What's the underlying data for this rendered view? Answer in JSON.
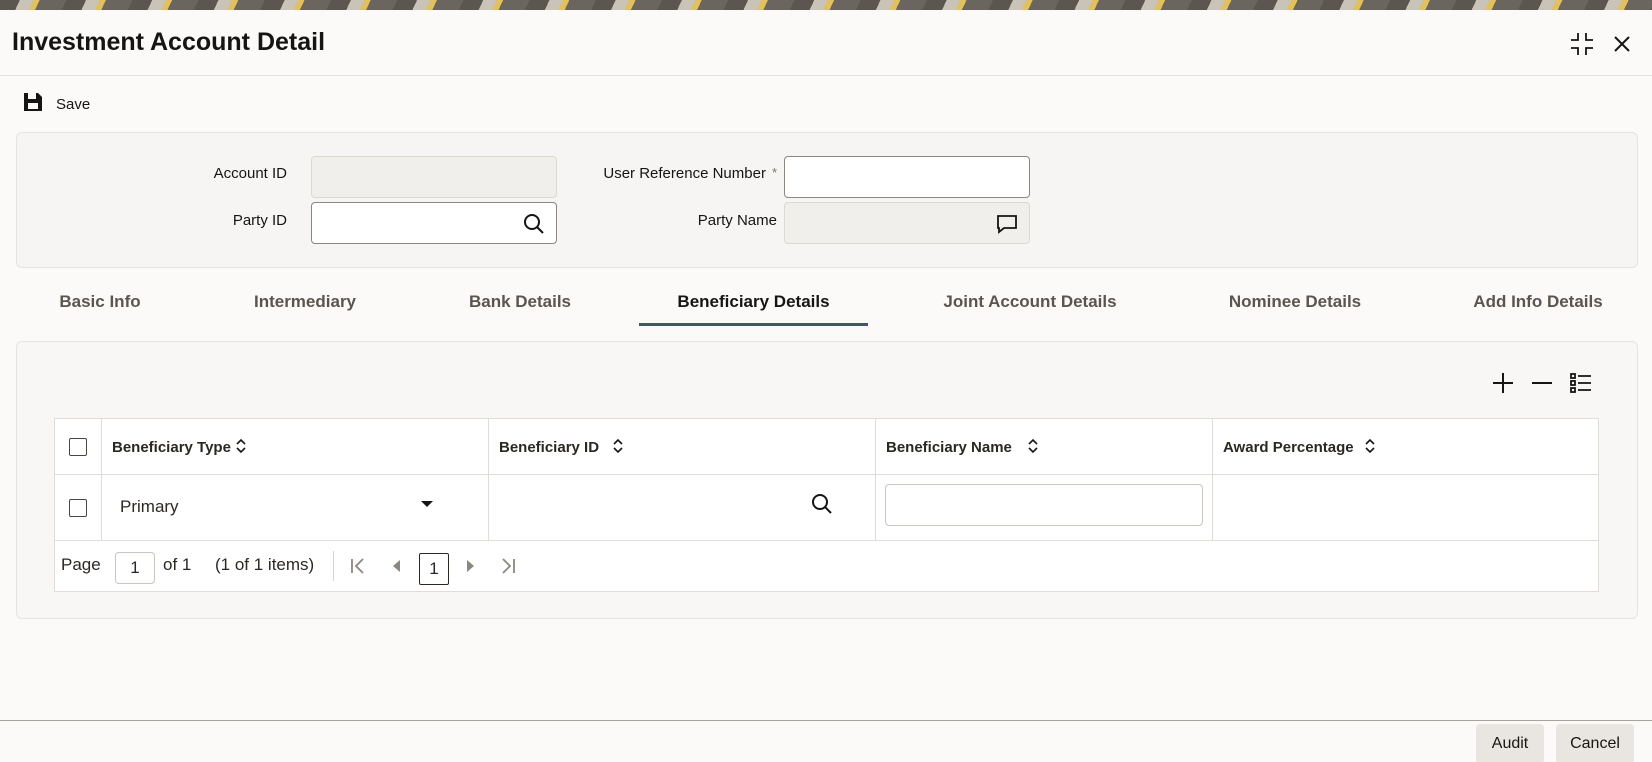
{
  "window": {
    "title": "Investment Account Detail"
  },
  "icons": {
    "maximize": "maximize-icon",
    "close": "close-icon",
    "save": "save-icon",
    "search": "search-icon",
    "message": "message-icon",
    "add": "plus-icon",
    "remove": "minus-icon",
    "columns": "list-icon",
    "sort": "sort-icon",
    "dropdown": "caret-down-icon"
  },
  "toolbar": {
    "save_label": "Save"
  },
  "header": {
    "account_id_label": "Account ID",
    "account_id_value": "",
    "party_id_label": "Party ID",
    "party_id_value": "",
    "user_ref_label": "User Reference Number",
    "user_ref_required": "*",
    "user_ref_value": "",
    "party_name_label": "Party Name",
    "party_name_value": ""
  },
  "tabs": [
    {
      "label": "Basic Info"
    },
    {
      "label": "Intermediary"
    },
    {
      "label": "Bank Details"
    },
    {
      "label": "Beneficiary Details",
      "active": true
    },
    {
      "label": "Joint Account Details"
    },
    {
      "label": "Nominee Details"
    },
    {
      "label": "Add Info Details"
    }
  ],
  "grid": {
    "columns": [
      "Beneficiary Type",
      "Beneficiary ID",
      "Beneficiary Name",
      "Award Percentage"
    ],
    "rows": [
      {
        "beneficiary_type": "Primary",
        "beneficiary_id": "",
        "beneficiary_name": "",
        "award_percentage": ""
      }
    ]
  },
  "pager": {
    "page_label": "Page",
    "page_value": "1",
    "of_text": "of 1",
    "items_text": "(1 of 1 items)",
    "current_page": "1"
  },
  "footer": {
    "audit_label": "Audit",
    "cancel_label": "Cancel"
  }
}
